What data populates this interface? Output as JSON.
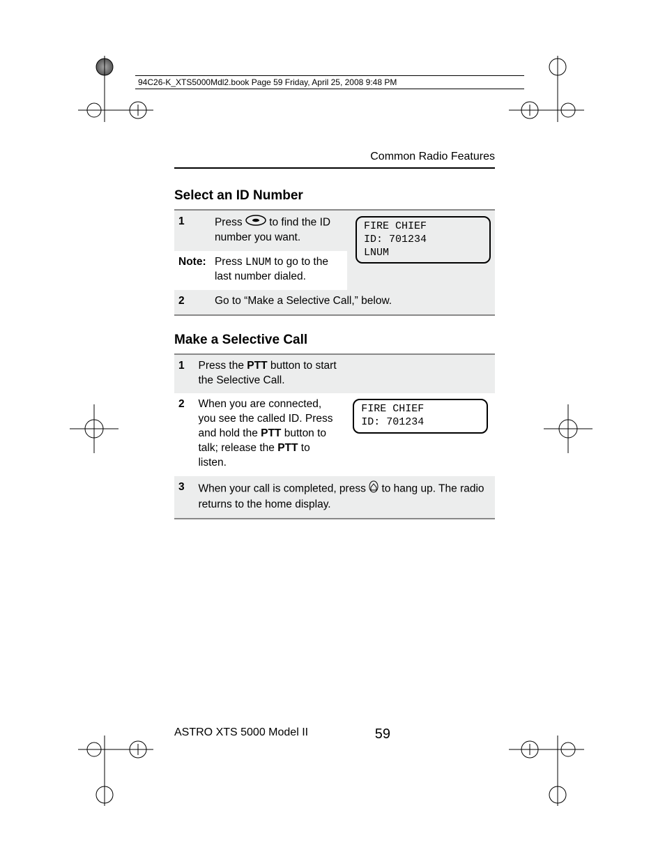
{
  "booktag": "94C26-K_XTS5000Mdl2.book  Page 59  Friday, April 25, 2008  9:48 PM",
  "header_right": "Common Radio Features",
  "section1": {
    "title": "Select an ID Number",
    "step1_num": "1",
    "step1_pre": "Press ",
    "step1_post": " to find the ID number you want.",
    "note_label": "Note:",
    "note_pre": "Press ",
    "note_mono": "LNUM",
    "note_post": " to go to the last number dialed.",
    "step2_num": "2",
    "step2_text": "Go to “Make a Selective Call,” below.",
    "screen": {
      "line1": "FIRE CHIEF",
      "line2": "ID: 701234",
      "line3": "LNUM"
    }
  },
  "section2": {
    "title": "Make a Selective Call",
    "step1_num": "1",
    "step1_pre": "Press the ",
    "step1_bold": "PTT",
    "step1_post": " button to start the Selective Call.",
    "step2_num": "2",
    "step2_pre": "When you are connected, you see the called ID. Press and hold the ",
    "step2_bold1": "PTT",
    "step2_mid": " button to talk; release the ",
    "step2_bold2": "PTT",
    "step2_post": " to listen.",
    "step3_num": "3",
    "step3_pre": "When your call is completed, press ",
    "step3_post": " to hang up. The radio returns to the home display.",
    "screen": {
      "line1": "FIRE CHIEF",
      "line2": "ID: 701234"
    }
  },
  "footer": {
    "left": "ASTRO XTS 5000 Model II",
    "right": "59"
  }
}
